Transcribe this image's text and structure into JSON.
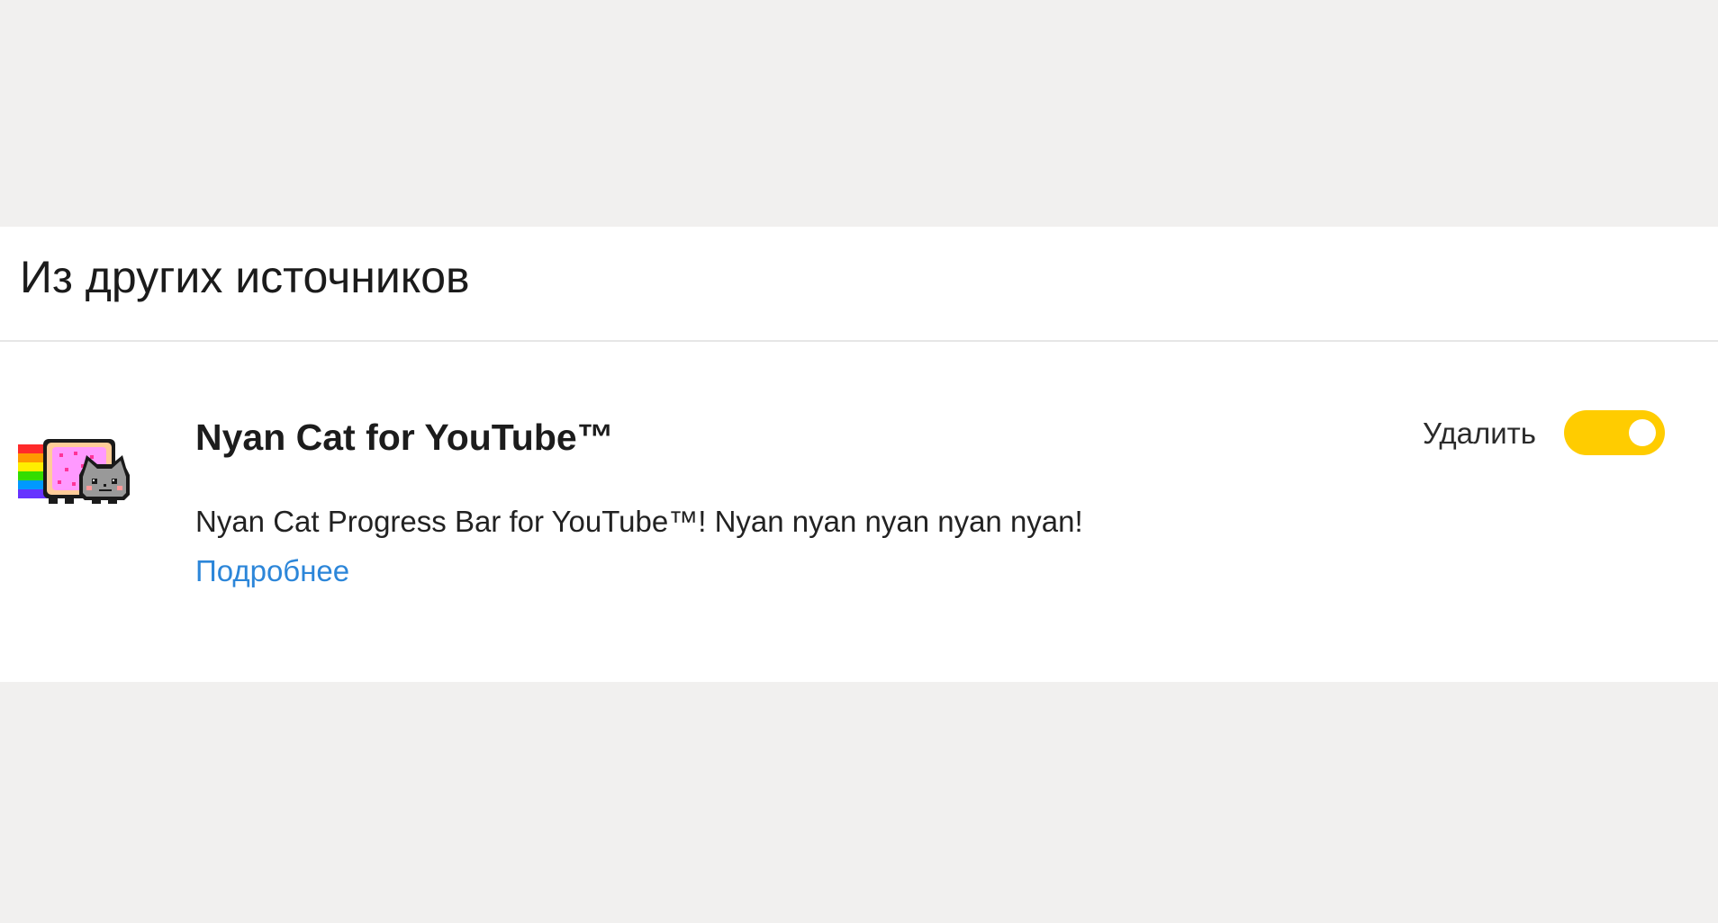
{
  "section": {
    "title": "Из других источников"
  },
  "extension": {
    "name": "Nyan Cat for YouTube™",
    "description": "Nyan Cat Progress Bar for YouTube™! Nyan nyan nyan nyan nyan!",
    "more_link": "Подробнее",
    "remove_label": "Удалить",
    "enabled": true,
    "icon": "nyan-cat-icon"
  },
  "colors": {
    "background": "#f1f0ef",
    "panel": "#ffffff",
    "toggle_on": "#ffcc00",
    "link": "#2c86d9",
    "divider": "#e6e6e6"
  }
}
